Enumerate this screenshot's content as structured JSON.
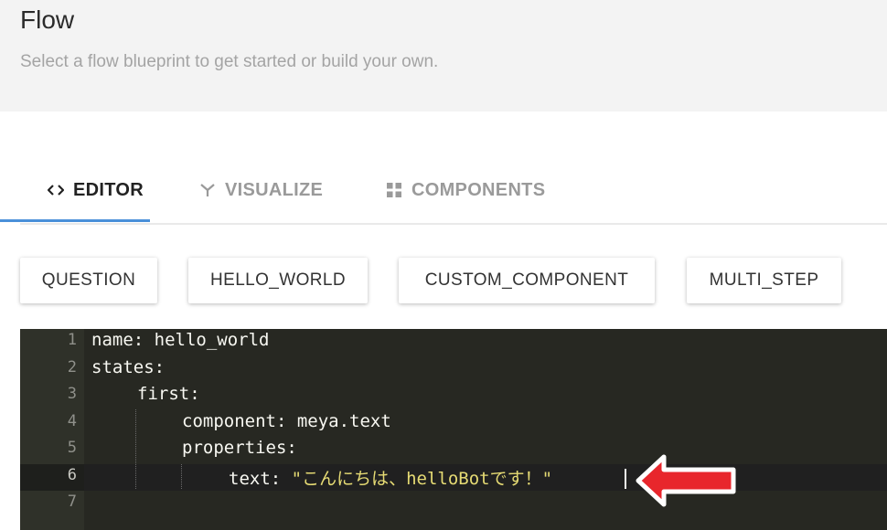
{
  "header": {
    "title": "Flow",
    "subtitle": "Select a flow blueprint to get started or build your own."
  },
  "tabs": [
    {
      "label": "EDITOR",
      "icon": "code-icon",
      "active": true
    },
    {
      "label": "VISUALIZE",
      "icon": "fork-icon",
      "active": false
    },
    {
      "label": "COMPONENTS",
      "icon": "grid-icon",
      "active": false
    }
  ],
  "blueprints": [
    "QUESTION",
    "HELLO_WORLD",
    "CUSTOM_COMPONENT",
    "MULTI_STEP"
  ],
  "editor": {
    "line_numbers": [
      "1",
      "2",
      "3",
      "4",
      "5",
      "6",
      "7"
    ],
    "lines": [
      {
        "key": "name:",
        "value": " hello_world"
      },
      {
        "key": "states:",
        "value": ""
      },
      {
        "key": "first:",
        "value": ""
      },
      {
        "key": "component:",
        "value": " meya.text"
      },
      {
        "key": "properties:",
        "value": ""
      },
      {
        "key": "text:",
        "value": "\"こんにちは、helloBotです！\""
      },
      {
        "key": "",
        "value": ""
      }
    ],
    "active_line": 6
  },
  "colors": {
    "accent": "#4a90d9",
    "editor_bg": "#272822",
    "string": "#e6db74",
    "annotation_arrow": "#e8262c"
  }
}
